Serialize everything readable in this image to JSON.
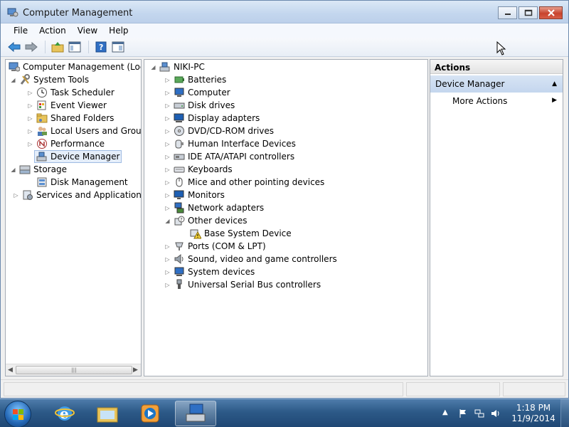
{
  "window": {
    "title": "Computer Management"
  },
  "menu": [
    "File",
    "Action",
    "View",
    "Help"
  ],
  "toolbar_icons": [
    "back-arrow-icon",
    "forward-arrow-icon",
    "up-folder-icon",
    "show-hide-tree-icon",
    "help-icon",
    "properties-pane-icon"
  ],
  "left_tree": {
    "root": "Computer Management (Local",
    "system_tools": "System Tools",
    "task_scheduler": "Task Scheduler",
    "event_viewer": "Event Viewer",
    "shared_folders": "Shared Folders",
    "local_users": "Local Users and Groups",
    "performance": "Performance",
    "device_manager": "Device Manager",
    "storage": "Storage",
    "disk_management": "Disk Management",
    "services": "Services and Applications"
  },
  "device_tree": {
    "computer": "NIKI-PC",
    "categories": [
      "Batteries",
      "Computer",
      "Disk drives",
      "Display adapters",
      "DVD/CD-ROM drives",
      "Human Interface Devices",
      "IDE ATA/ATAPI controllers",
      "Keyboards",
      "Mice and other pointing devices",
      "Monitors",
      "Network adapters",
      "Other devices",
      "Base System Device",
      "Ports (COM & LPT)",
      "Sound, video and game controllers",
      "System devices",
      "Universal Serial Bus controllers"
    ]
  },
  "actions": {
    "header": "Actions",
    "section": "Device Manager",
    "more": "More Actions"
  },
  "clock": {
    "time": "1:18 PM",
    "date": "11/9/2014"
  },
  "colors": {
    "selection": "#e5eefa",
    "actions_section": "#c4d6ee",
    "taskbar": "#2d5a88"
  }
}
